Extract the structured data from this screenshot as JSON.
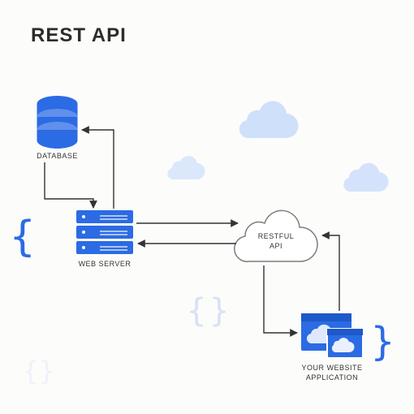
{
  "title": "REST API",
  "nodes": {
    "database": {
      "label": "DATABASE"
    },
    "web_server": {
      "label": "WEB SERVER"
    },
    "restful_api": {
      "label": "RESTFUL\nAPI"
    },
    "client": {
      "label": "YOUR WEBSITE\nAPPLICATION"
    }
  },
  "edges": [
    {
      "from": "database",
      "to": "web_server"
    },
    {
      "from": "web_server",
      "to": "database"
    },
    {
      "from": "web_server",
      "to": "restful_api"
    },
    {
      "from": "restful_api",
      "to": "web_server"
    },
    {
      "from": "restful_api",
      "to": "client"
    },
    {
      "from": "client",
      "to": "restful_api"
    }
  ],
  "colors": {
    "brand": "#2b6be4",
    "line": "#333"
  }
}
